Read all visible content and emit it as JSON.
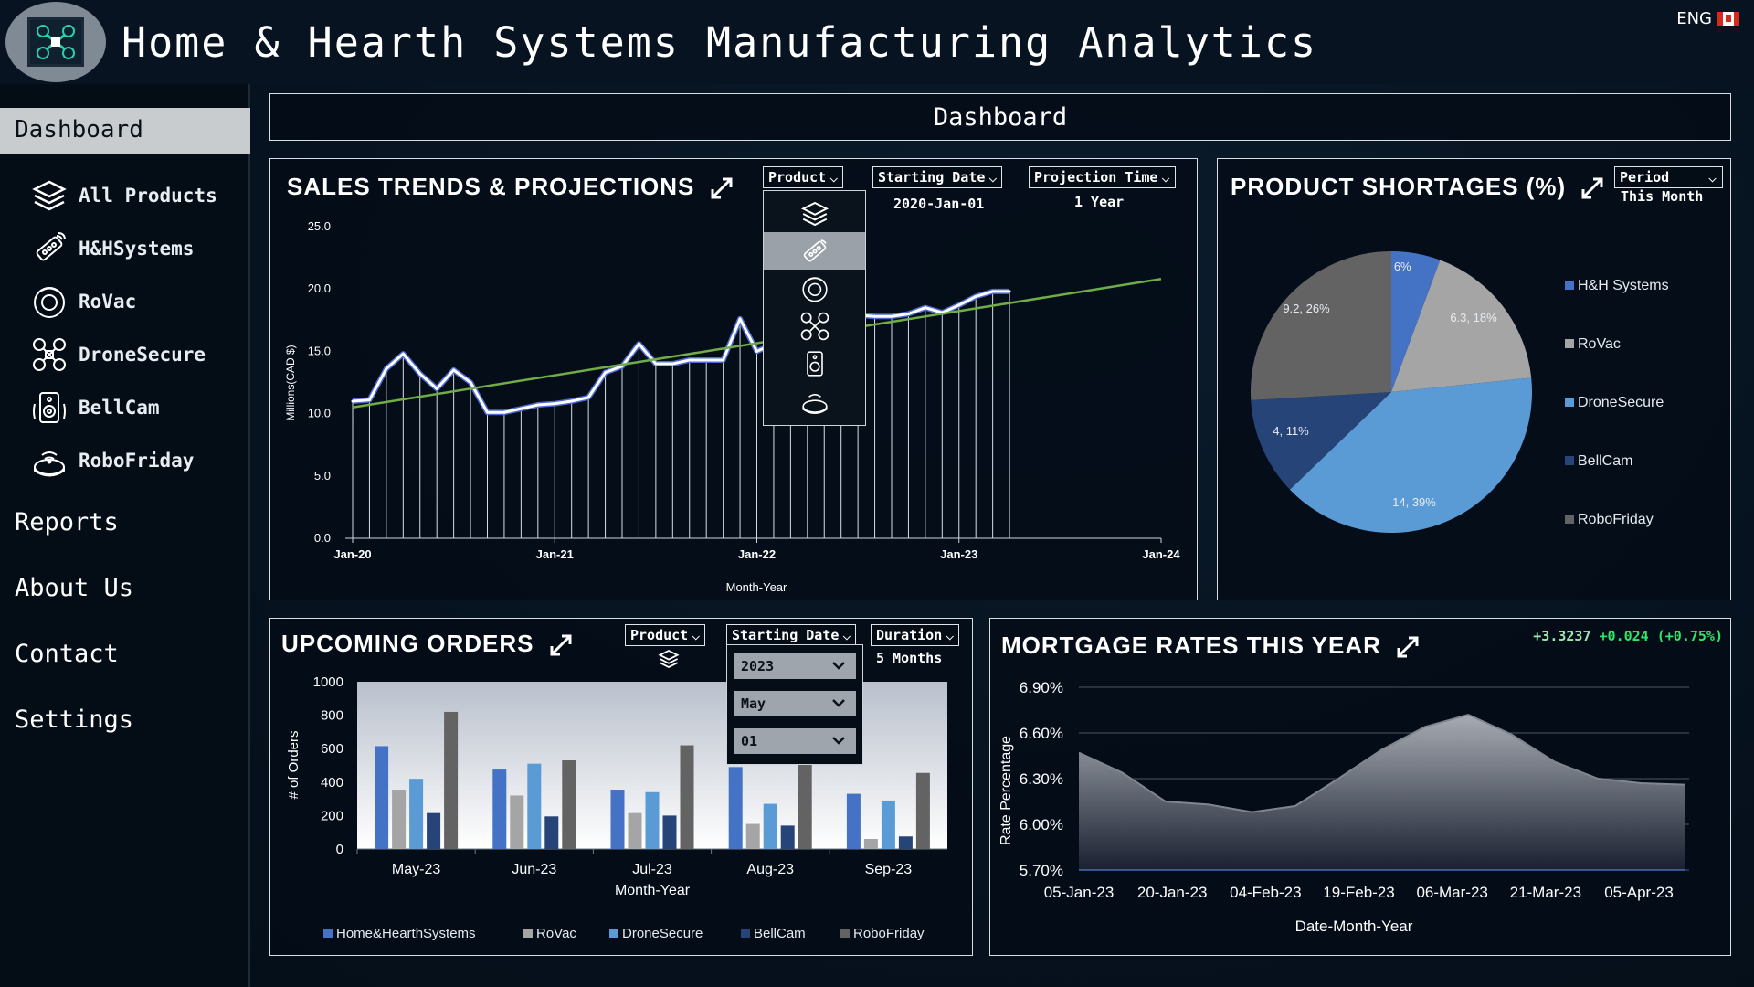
{
  "header": {
    "title": "Home & Hearth Systems Manufacturing Analytics",
    "lang": "ENG"
  },
  "sidebar": {
    "active": "Dashboard",
    "products": [
      {
        "label": "All Products",
        "icon": "layers-icon"
      },
      {
        "label": "H&HSystems",
        "icon": "remote-control-icon"
      },
      {
        "label": "RoVac",
        "icon": "robot-vacuum-icon"
      },
      {
        "label": "DroneSecure",
        "icon": "drone-icon"
      },
      {
        "label": "BellCam",
        "icon": "doorbell-camera-icon"
      },
      {
        "label": "RoboFriday",
        "icon": "robot-icon"
      }
    ],
    "nav": [
      "Reports",
      "About Us",
      "Contact",
      "Settings"
    ]
  },
  "dashboard_banner": "Dashboard",
  "sales": {
    "title": "SALES TRENDS & PROJECTIONS",
    "product_label": "Product",
    "start_label": "Starting Date",
    "start_value": "2020-Jan-01",
    "proj_label": "Projection Time",
    "proj_value": "1 Year",
    "product_menu_icons": [
      "layers-icon",
      "remote-control-icon",
      "robot-vacuum-icon",
      "drone-icon",
      "doorbell-camera-icon",
      "robot-icon"
    ]
  },
  "shortages": {
    "title": "PRODUCT SHORTAGES (%)",
    "period_label": "Period",
    "period_value": "This Month"
  },
  "orders": {
    "title": "UPCOMING ORDERS",
    "product_label": "Product",
    "start_label": "Starting Date",
    "duration_label": "Duration",
    "duration_value": "5 Months",
    "date_picker": {
      "year": "2023",
      "month": "May",
      "day": "01"
    }
  },
  "mortgage": {
    "title": "MORTGAGE RATES THIS YEAR",
    "ticker_value": "+3.3237",
    "ticker_change": "+0.024 (+0.75%)"
  },
  "chart_data": [
    {
      "type": "line",
      "name": "sales",
      "ylabel": "Millions(CAD $)",
      "xlabel": "Month-Year",
      "ylim": [
        0,
        25
      ],
      "yticks": [
        "0.0",
        "5.0",
        "10.0",
        "15.0",
        "20.0",
        "25.0"
      ],
      "xticks": [
        "Jan-20",
        "Jan-21",
        "Jan-22",
        "Jan-23",
        "Jan-24"
      ],
      "series": [
        {
          "values": [
            11.0,
            11.1,
            13.6,
            14.8,
            13.2,
            12.0,
            13.5,
            12.5,
            10.1,
            10.1,
            10.4,
            10.7,
            10.8,
            11.0,
            11.3,
            13.3,
            13.8,
            15.6,
            14.0,
            14.0,
            14.3,
            14.3,
            14.3,
            17.6,
            15.0,
            15.6,
            16.3,
            16.6,
            17.3,
            17.7,
            17.9,
            17.8,
            17.8,
            18.0,
            18.5,
            18.1,
            18.7,
            19.4,
            19.8,
            19.8
          ],
          "start": "Jan-20"
        }
      ],
      "trend": {
        "start": [
          "Jan-20",
          10.5
        ],
        "end": [
          "Jan-24",
          20.8
        ]
      }
    },
    {
      "type": "pie",
      "name": "shortages",
      "slices": [
        {
          "name": "H&H Systems",
          "value": 2,
          "pct": 6,
          "label": "2, 6%",
          "color": "#4472c4"
        },
        {
          "name": "RoVac",
          "value": 6.3,
          "pct": 18,
          "label": "6.3, 18%",
          "color": "#a5a5a5"
        },
        {
          "name": "DroneSecure",
          "value": 14,
          "pct": 39,
          "label": "14, 39%",
          "color": "#5b9bd5"
        },
        {
          "name": "BellCam",
          "value": 4,
          "pct": 11,
          "label": "4, 11%",
          "color": "#264478"
        },
        {
          "name": "RoboFriday",
          "value": 9.2,
          "pct": 26,
          "label": "9.2, 26%",
          "color": "#636363"
        }
      ],
      "legend": "right"
    },
    {
      "type": "bar",
      "name": "orders",
      "ylabel": "# of Orders",
      "xlabel": "Month-Year",
      "ylim": [
        0,
        1000
      ],
      "yticks": [
        "0",
        "200",
        "400",
        "600",
        "800",
        "1000"
      ],
      "categories": [
        "May-23",
        "Jun-23",
        "Jul-23",
        "Aug-23",
        "Sep-23"
      ],
      "series": [
        {
          "name": "Home&HearthSystems",
          "color": "#4472c4",
          "values": [
            615,
            475,
            355,
            490,
            330
          ]
        },
        {
          "name": "RoVac",
          "color": "#a5a5a5",
          "values": [
            355,
            320,
            215,
            150,
            60
          ]
        },
        {
          "name": "DroneSecure",
          "color": "#5b9bd5",
          "values": [
            420,
            510,
            340,
            270,
            290
          ]
        },
        {
          "name": "BellCam",
          "color": "#264478",
          "values": [
            215,
            195,
            200,
            140,
            75
          ]
        },
        {
          "name": "RoboFriday",
          "color": "#636363",
          "values": [
            820,
            530,
            620,
            520,
            455
          ]
        }
      ],
      "legend": "bottom"
    },
    {
      "type": "area",
      "name": "mortgage",
      "ylabel": "Rate Percentage",
      "xlabel": "Date-Month-Year",
      "ylim": [
        5.7,
        6.9
      ],
      "yticks": [
        "5.70%",
        "6.00%",
        "6.30%",
        "6.60%",
        "6.90%"
      ],
      "xticks": [
        "05-Jan-23",
        "20-Jan-23",
        "04-Feb-23",
        "19-Feb-23",
        "06-Mar-23",
        "21-Mar-23",
        "05-Apr-23"
      ],
      "values": [
        6.47,
        6.34,
        6.15,
        6.13,
        6.08,
        6.12,
        6.3,
        6.49,
        6.64,
        6.72,
        6.59,
        6.41,
        6.3,
        6.27,
        6.26
      ]
    }
  ]
}
